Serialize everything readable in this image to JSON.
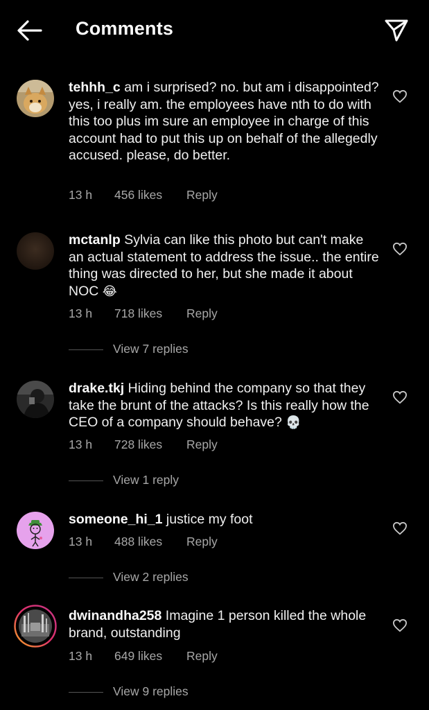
{
  "header": {
    "title": "Comments"
  },
  "comments": [
    {
      "username": "tehhh_c",
      "text": "am i surprised? no. but am i disappointed? yes, i really am. the employees have nth to do with this too plus im sure an employee in charge of this account had to put this up on behalf of the allegedly accused. please, do better.",
      "time": "13 h",
      "likes": "456 likes",
      "reply": "Reply"
    },
    {
      "username": "mctanlp",
      "text": "Sylvia can like this photo but can't make an actual statement to address the issue.. the entire thing was directed to her, but she made it about NOC",
      "emoji": "😂",
      "time": "13 h",
      "likes": "718 likes",
      "reply": "Reply",
      "view_replies": "View 7 replies"
    },
    {
      "username": "drake.tkj",
      "text": "Hiding behind the company so that they take the brunt of the attacks? Is this really how the CEO of a company should behave?",
      "emoji": "💀",
      "time": "13 h",
      "likes": "728 likes",
      "reply": "Reply",
      "view_replies": "View 1 reply"
    },
    {
      "username": "someone_hi_1",
      "text": "justice my foot",
      "time": "13 h",
      "likes": "488 likes",
      "reply": "Reply",
      "view_replies": "View 2 replies"
    },
    {
      "username": "dwinandha258",
      "text": "Imagine 1 person killed the whole brand, outstanding",
      "time": "13 h",
      "likes": "649 likes",
      "reply": "Reply",
      "view_replies": "View 9 replies"
    }
  ],
  "icons": {
    "back": "arrow-left-icon",
    "send": "paper-plane-icon",
    "like": "heart-outline-icon"
  },
  "colors": {
    "background": "#000000",
    "text": "#f5f5f5",
    "secondary_text": "#a8a8a8",
    "story_ring": "#c13584"
  }
}
